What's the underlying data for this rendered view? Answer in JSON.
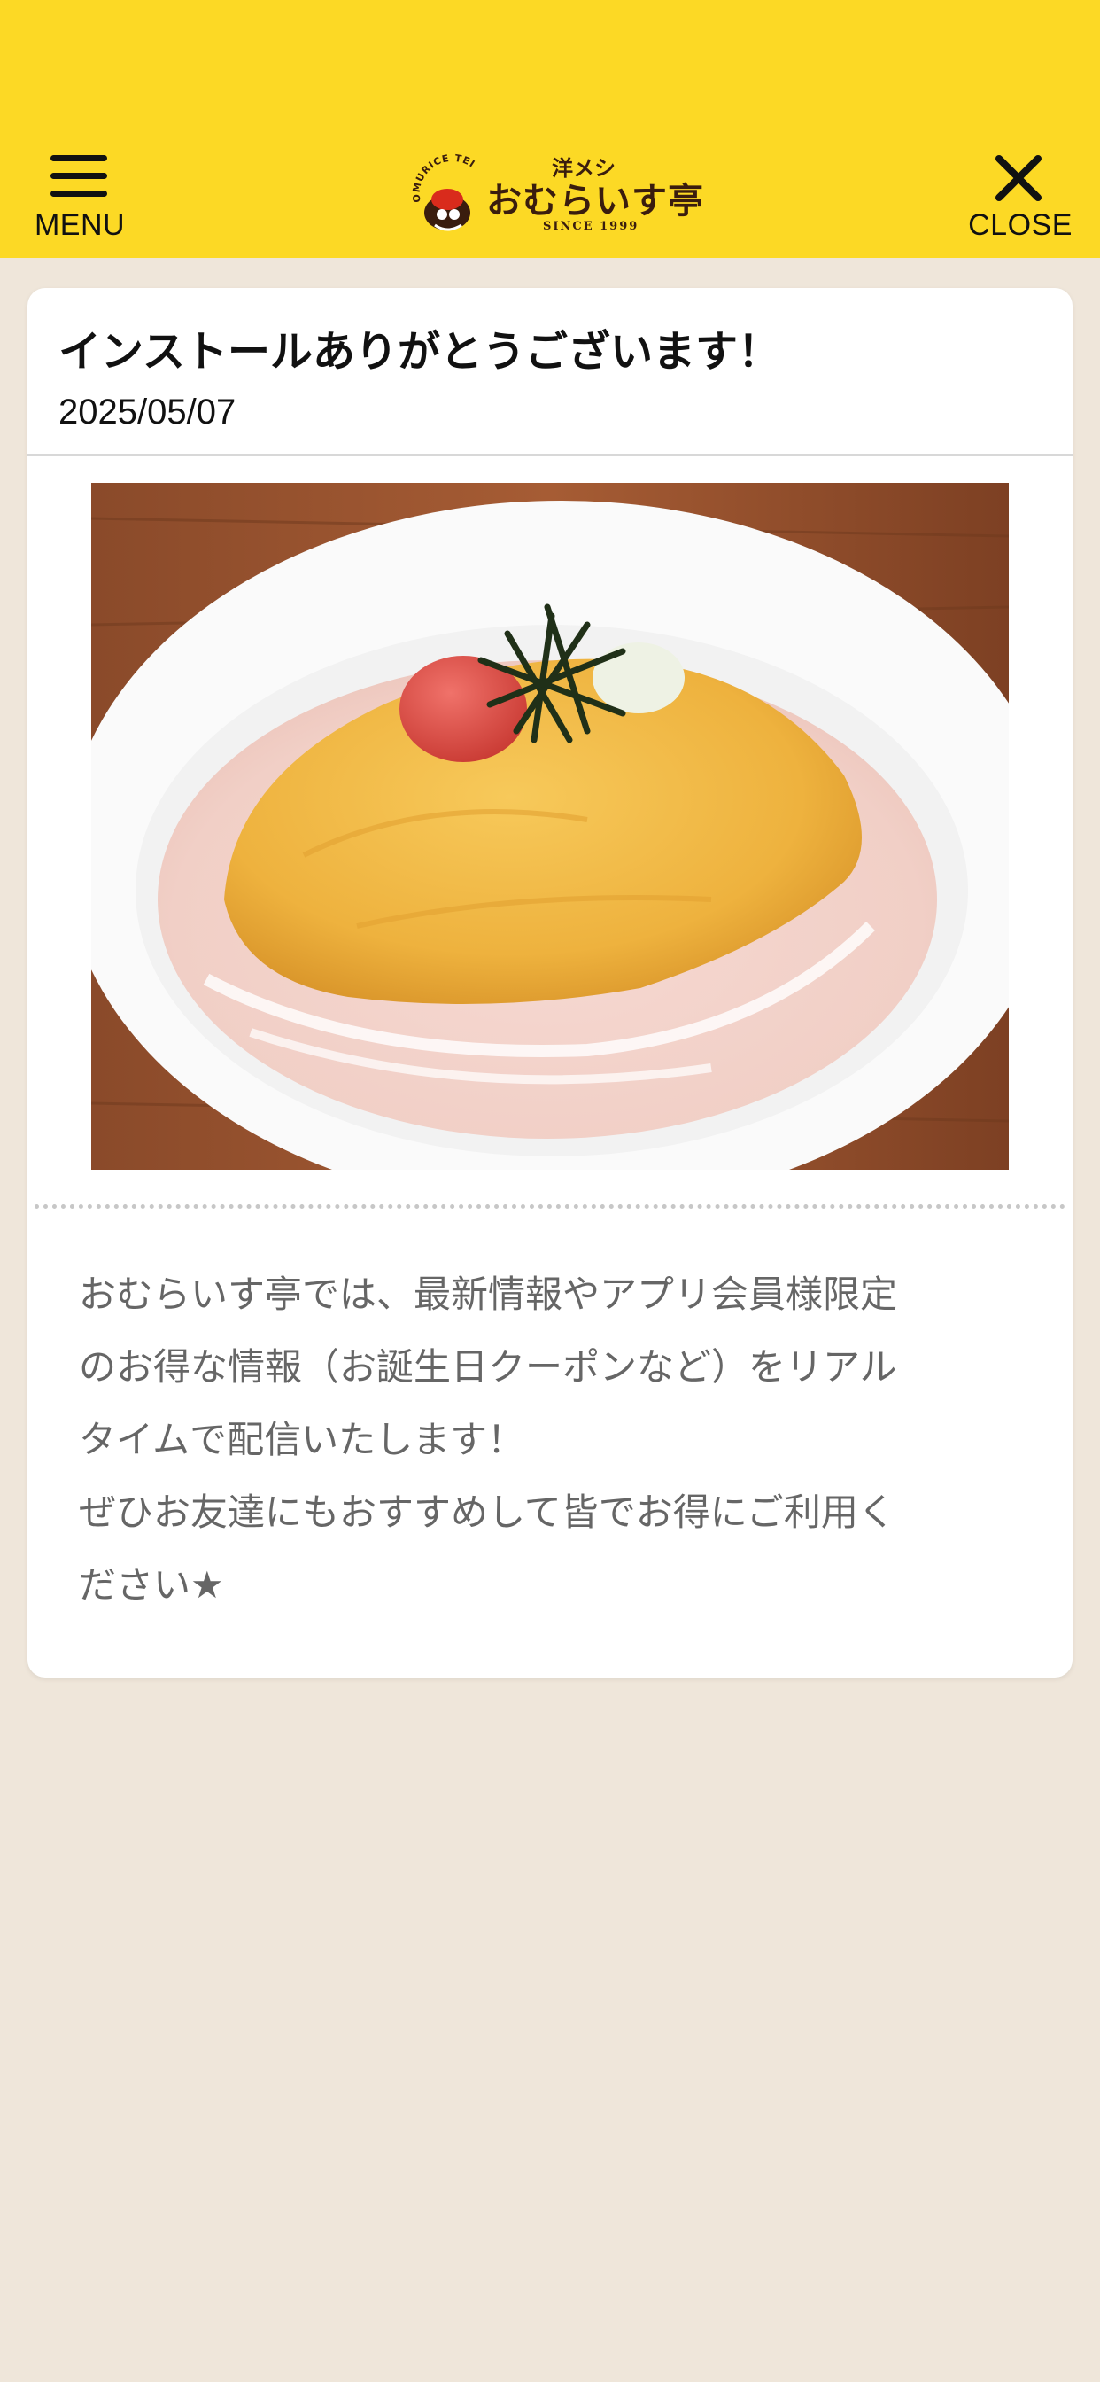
{
  "colors": {
    "header_bg": "#fcd925",
    "page_bg": "#efe6da",
    "card_bg": "#ffffff",
    "body_text": "#666666"
  },
  "header": {
    "menu_label": "MENU",
    "close_label": "CLOSE",
    "menu_icon": "hamburger-icon",
    "close_icon": "close-icon",
    "logo": {
      "badge_text": "OMURICE TEI",
      "top_text": "洋メシ",
      "name": "おむらいす亭",
      "since": "SINCE 1999"
    }
  },
  "article": {
    "title": "インストールありがとうございます！",
    "date": "2025/05/07",
    "image_alt": "omurice dish",
    "body_lines": [
      "おむらいす亭では、最新情報やアプリ会員様限定",
      "のお得な情報（お誕生日クーポンなど）をリアル",
      "タイムで配信いたします！",
      "ぜひお友達にもおすすめして皆でお得にご利用く",
      "ださい★"
    ]
  }
}
